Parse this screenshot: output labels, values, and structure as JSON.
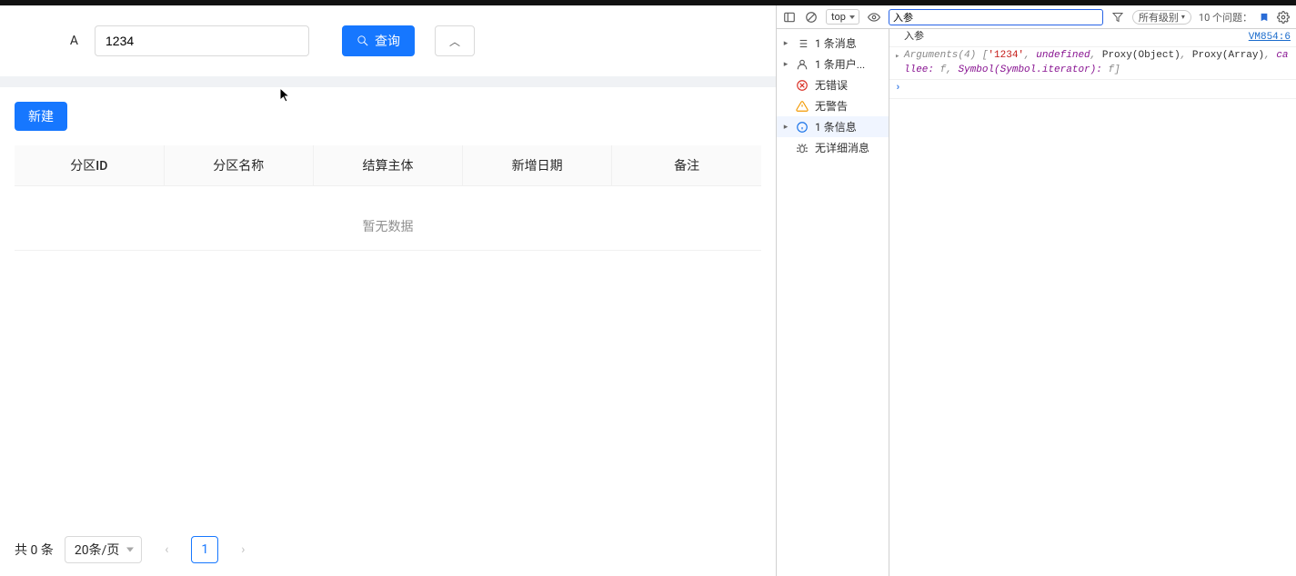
{
  "search": {
    "label": "A",
    "value": "1234",
    "query_button": "查询"
  },
  "toolbar": {
    "new_button": "新建"
  },
  "table": {
    "columns": [
      "分区ID",
      "分区名称",
      "结算主体",
      "新增日期",
      "备注"
    ],
    "empty_text": "暂无数据"
  },
  "pagination": {
    "total_text": "共 0 条",
    "page_size_label": "20条/页",
    "current_page": "1"
  },
  "devtools": {
    "top": {
      "context": "top",
      "filter_value": "入参",
      "level_label": "所有级别",
      "issues_count": "10",
      "issues_text": "个问题："
    },
    "sidebar": {
      "messages": "1 条消息",
      "user_messages": "1 条用户...",
      "no_errors": "无错误",
      "no_warnings": "无警告",
      "info": "1 条信息",
      "no_verbose": "无详细消息"
    },
    "log": {
      "title": "入参",
      "source_link": "VM854:6",
      "args_prefix": "Arguments(4) [",
      "arg0": "'1234'",
      "arg1": "undefined",
      "arg2": "Proxy(Object)",
      "arg3": "Proxy(Array)",
      "callee_key": "callee:",
      "callee_val": "f",
      "symbol_key": "Symbol(Symbol.iterator):",
      "symbol_val": "f",
      "close": "]"
    }
  }
}
